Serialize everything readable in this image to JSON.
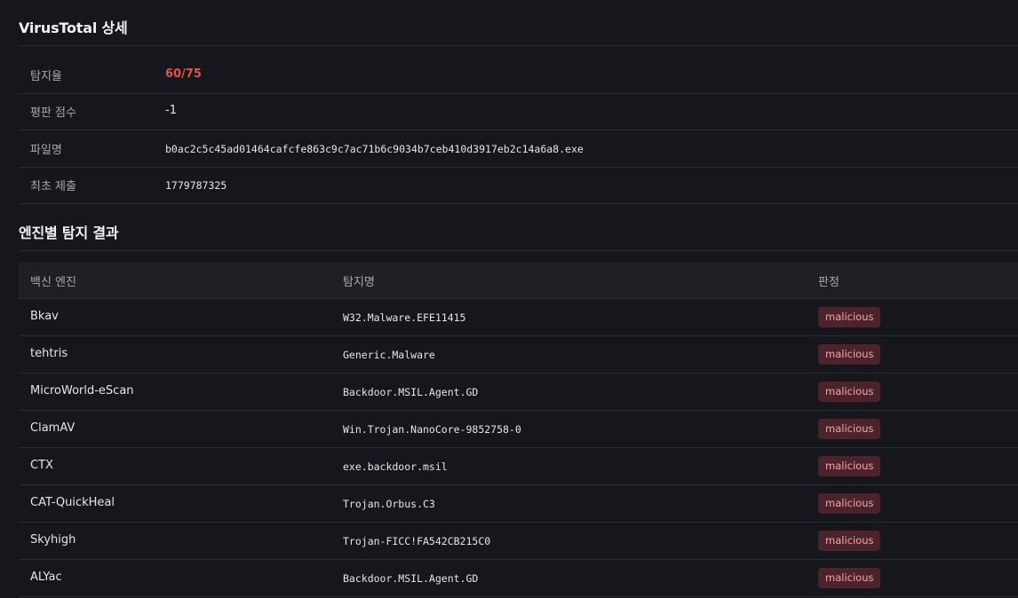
{
  "vt_section": {
    "title": "VirusTotal 상세"
  },
  "details": [
    {
      "label": "탐지율",
      "value": "60/75"
    },
    {
      "label": "평판 점수",
      "value": "-1"
    },
    {
      "label": "파일명",
      "value": "b0ac2c5c45ad01464cafcfe863c9c7ac71b6c9034b7ceb410d3917eb2c14a6a8.exe"
    },
    {
      "label": "최초 제출",
      "value": "1779787325"
    }
  ],
  "engine_section": {
    "title": "엔진별 탐지 결과"
  },
  "table": {
    "headers": [
      "백신 엔진",
      "탐지명",
      "판정"
    ],
    "rows": [
      {
        "engine": "Bkav",
        "detection": "W32.Malware.EFE11415",
        "verdict": "malicious"
      },
      {
        "engine": "tehtris",
        "detection": "Generic.Malware",
        "verdict": "malicious"
      },
      {
        "engine": "MicroWorld-eScan",
        "detection": "Backdoor.MSIL.Agent.GD",
        "verdict": "malicious"
      },
      {
        "engine": "ClamAV",
        "detection": "Win.Trojan.NanoCore-9852758-0",
        "verdict": "malicious"
      },
      {
        "engine": "CTX",
        "detection": "exe.backdoor.msil",
        "verdict": "malicious"
      },
      {
        "engine": "CAT-QuickHeal",
        "detection": "Trojan.Orbus.C3",
        "verdict": "malicious"
      },
      {
        "engine": "Skyhigh",
        "detection": "Trojan-FICC!FA542CB215C0",
        "verdict": "malicious"
      },
      {
        "engine": "ALYac",
        "detection": "Backdoor.MSIL.Agent.GD",
        "verdict": "malicious"
      }
    ]
  },
  "colors": {
    "background": "#16171c",
    "detection_rate": "#ef4b4b",
    "badge_bg": "#4a232b",
    "badge_text": "#f1a5b0"
  }
}
